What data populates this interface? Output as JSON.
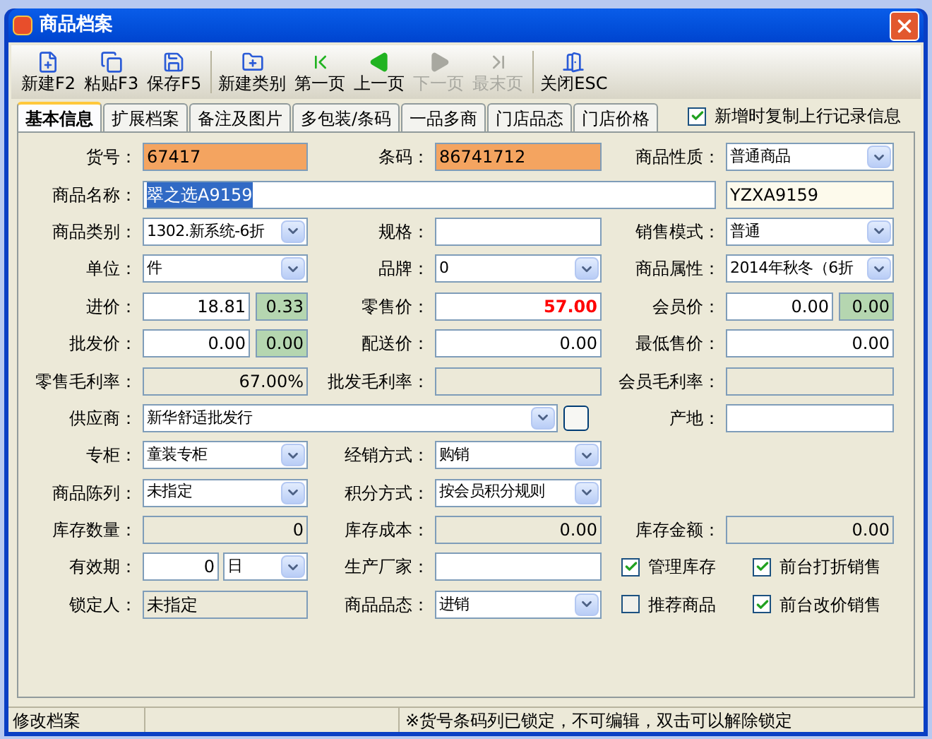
{
  "window": {
    "title": "商品档案"
  },
  "toolbar": [
    [
      {
        "label": "新建F2",
        "disabled": false
      },
      {
        "label": "粘贴F3",
        "disabled": false
      },
      {
        "label": "保存F5",
        "disabled": false
      }
    ],
    [
      {
        "label": "新建类别",
        "disabled": false
      },
      {
        "label": "第一页",
        "disabled": false
      },
      {
        "label": "上一页",
        "disabled": false
      },
      {
        "label": "下一页",
        "disabled": true
      },
      {
        "label": "最末页",
        "disabled": true
      }
    ],
    [
      {
        "label": "关闭ESC",
        "disabled": false
      }
    ]
  ],
  "tabs": [
    {
      "label": "基本信息",
      "selected": true
    },
    {
      "label": "扩展档案",
      "selected": false
    },
    {
      "label": "备注及图片",
      "selected": false
    },
    {
      "label": "多包装/条码",
      "selected": false
    },
    {
      "label": "一品多商",
      "selected": false
    },
    {
      "label": "门店品态",
      "selected": false
    },
    {
      "label": "门店价格",
      "selected": false
    }
  ],
  "copy_option": {
    "label": "新增时复制上行记录信息",
    "checked": true
  },
  "rows": [
    {
      "cells": [
        {
          "kind": "text",
          "label": "货号：",
          "value": "67417",
          "locked": true
        },
        {
          "kind": "text",
          "label": "条码：",
          "value": "86741712",
          "locked": true
        },
        {
          "kind": "combo",
          "label": "商品性质：",
          "value": "普通商品"
        }
      ]
    },
    {
      "cells": [
        {
          "kind": "wide",
          "label": "商品名称：",
          "value": "翠之选A9159",
          "selected": true
        },
        {
          "kind": "code",
          "value": "YZXA9159"
        }
      ]
    },
    {
      "cells": [
        {
          "kind": "combo",
          "label": "商品类别：",
          "value": "1302.新系统-6折"
        },
        {
          "kind": "text",
          "label": "规格：",
          "locked": false,
          "readonly": false
        },
        {
          "kind": "combo",
          "label": "销售模式：",
          "value": "普通"
        }
      ]
    },
    {
      "cells": [
        {
          "kind": "combo",
          "label": "单位：",
          "value": "件"
        },
        {
          "kind": "combo",
          "label": "品牌：",
          "value": "0"
        },
        {
          "kind": "combo",
          "label": "商品属性：",
          "value": "2014年秋冬（6折"
        }
      ]
    },
    {
      "cells": [
        {
          "kind": "price",
          "label": "进价：",
          "value": "18.81",
          "extra": "0.33"
        },
        {
          "kind": "number",
          "label": "零售价：",
          "value": "57.00",
          "readonly": false,
          "emphasis": true
        },
        {
          "kind": "price",
          "label": "会员价：",
          "value": "0.00",
          "extra": "0.00"
        }
      ]
    },
    {
      "cells": [
        {
          "kind": "price",
          "label": "批发价：",
          "value": "0.00",
          "extra": "0.00"
        },
        {
          "kind": "number",
          "label": "配送价：",
          "value": "0.00",
          "readonly": false,
          "emphasis": false
        },
        {
          "kind": "number",
          "label": "最低售价：",
          "value": "0.00",
          "readonly": false,
          "emphasis": false
        }
      ]
    },
    {
      "cells": [
        {
          "kind": "number",
          "label": "零售毛利率：",
          "value": "67.00%",
          "readonly": true,
          "emphasis": false
        },
        {
          "kind": "number",
          "label": "批发毛利率：",
          "readonly": true
        },
        {
          "kind": "number",
          "label": "会员毛利率：",
          "readonly": true
        }
      ]
    },
    {
      "cells": [
        {
          "kind": "supplier",
          "label": "供应商：",
          "value": "新华舒适批发行"
        },
        {
          "kind": "text",
          "label": "产地：",
          "locked": false,
          "readonly": false
        }
      ]
    },
    {
      "cells": [
        {
          "kind": "combo",
          "label": "专柜：",
          "value": "童装专柜"
        },
        {
          "kind": "combo",
          "label": "经销方式：",
          "value": "购销"
        }
      ]
    },
    {
      "cells": [
        {
          "kind": "combo",
          "label": "商品陈列：",
          "value": "未指定"
        },
        {
          "kind": "combo",
          "label": "积分方式：",
          "value": "按会员积分规则"
        }
      ]
    },
    {
      "cells": [
        {
          "kind": "number",
          "label": "库存数量：",
          "value": "0",
          "readonly": true,
          "emphasis": false
        },
        {
          "kind": "number",
          "label": "库存成本：",
          "value": "0.00",
          "readonly": true,
          "emphasis": false
        },
        {
          "kind": "number",
          "label": "库存金额：",
          "value": "0.00",
          "readonly": true,
          "emphasis": false
        }
      ]
    },
    {
      "cells": [
        {
          "kind": "period",
          "label": "有效期：",
          "value": "0",
          "unit": "日"
        },
        {
          "kind": "text",
          "label": "生产厂家：",
          "locked": false,
          "readonly": false
        },
        {
          "kind": "checks",
          "items": [
            {
              "label": "管理库存",
              "checked": true
            },
            {
              "label": "前台打折销售",
              "checked": true
            }
          ]
        }
      ]
    },
    {
      "cells": [
        {
          "kind": "text",
          "label": "锁定人：",
          "value": "未指定",
          "locked": false,
          "readonly": true
        },
        {
          "kind": "combo",
          "label": "商品品态：",
          "value": "进销"
        },
        {
          "kind": "checks",
          "items": [
            {
              "label": "推荐商品",
              "checked": false
            },
            {
              "label": "前台改价销售",
              "checked": true
            }
          ]
        }
      ]
    }
  ],
  "status_bar": [
    "修改档案",
    "※货号条码列已锁定，不可编辑，双击可以解除锁定"
  ]
}
